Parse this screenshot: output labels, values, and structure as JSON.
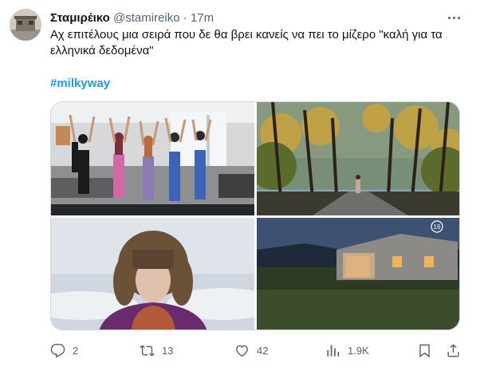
{
  "tweet": {
    "author": {
      "name": "Σταμιρέικο",
      "handle": "@stamireiko",
      "separator": "·",
      "time": "17m"
    },
    "text": "Αχ επιτέλους μια σειρά που δε θα βρει κανείς να πει το μίζερο \"καλή για τα ελληνικά δεδομένα\"",
    "hashtag": "#milkyway",
    "media": {
      "badge": "16"
    },
    "actions": {
      "replies": "2",
      "retweets": "13",
      "likes": "42",
      "views": "1.9K"
    }
  },
  "icons": {
    "more": "more-dots-icon",
    "reply": "reply-icon",
    "retweet": "retweet-icon",
    "like": "heart-icon",
    "views": "views-chart-icon",
    "bookmark": "bookmark-icon",
    "share": "share-icon"
  },
  "colors": {
    "link": "#1d9bf0",
    "secondary_text": "#536471",
    "primary_text": "#0f1419"
  }
}
